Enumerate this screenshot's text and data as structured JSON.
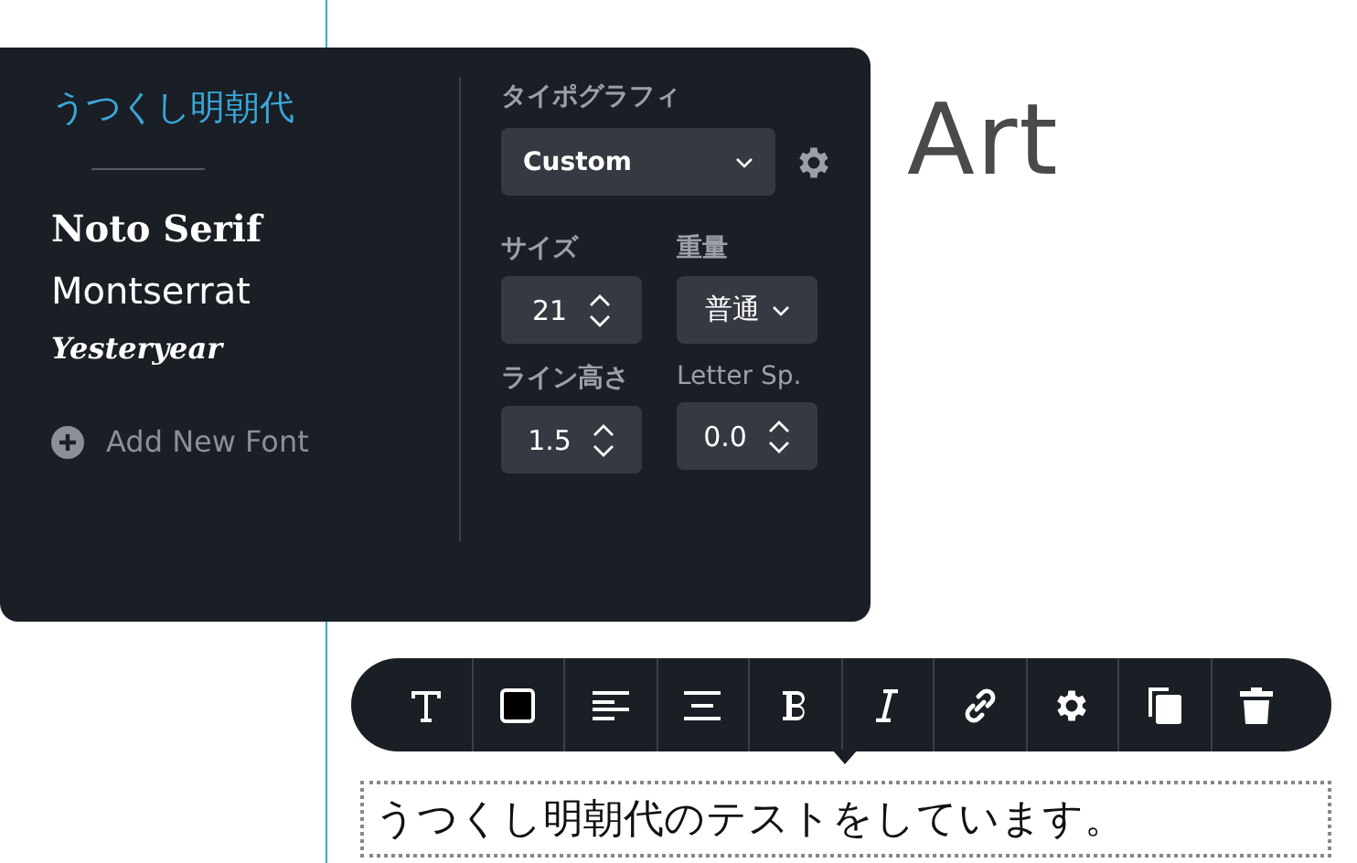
{
  "heading": {
    "lines": [
      "Art"
    ]
  },
  "font_panel": {
    "fonts": [
      {
        "name": "うつくし明朝代",
        "kind": "mincho",
        "selected": true
      },
      {
        "name": "Noto Serif",
        "kind": "serif",
        "selected": false
      },
      {
        "name": "Montserrat",
        "kind": "sans",
        "selected": false
      },
      {
        "name": "Yesteryear",
        "kind": "script",
        "selected": false
      }
    ],
    "add_font": "Add New Font",
    "typography": {
      "label": "タイポグラフィ",
      "value": "Custom"
    },
    "size": {
      "label": "サイズ",
      "value": "21"
    },
    "weight": {
      "label": "重量",
      "value": "普通"
    },
    "line_height": {
      "label": "ライン高さ",
      "value": "1.5"
    },
    "letter_spacing": {
      "label": "Letter Sp.",
      "value": "0.0"
    }
  },
  "toolbar": {
    "tools": [
      {
        "kind": "text"
      },
      {
        "kind": "color"
      },
      {
        "kind": "align-left"
      },
      {
        "kind": "align-center"
      },
      {
        "kind": "bold"
      },
      {
        "kind": "italic"
      },
      {
        "kind": "link"
      },
      {
        "kind": "settings"
      },
      {
        "kind": "copy"
      },
      {
        "kind": "delete"
      }
    ]
  },
  "text_box": {
    "value": "うつくし明朝代のテストをしています。"
  }
}
